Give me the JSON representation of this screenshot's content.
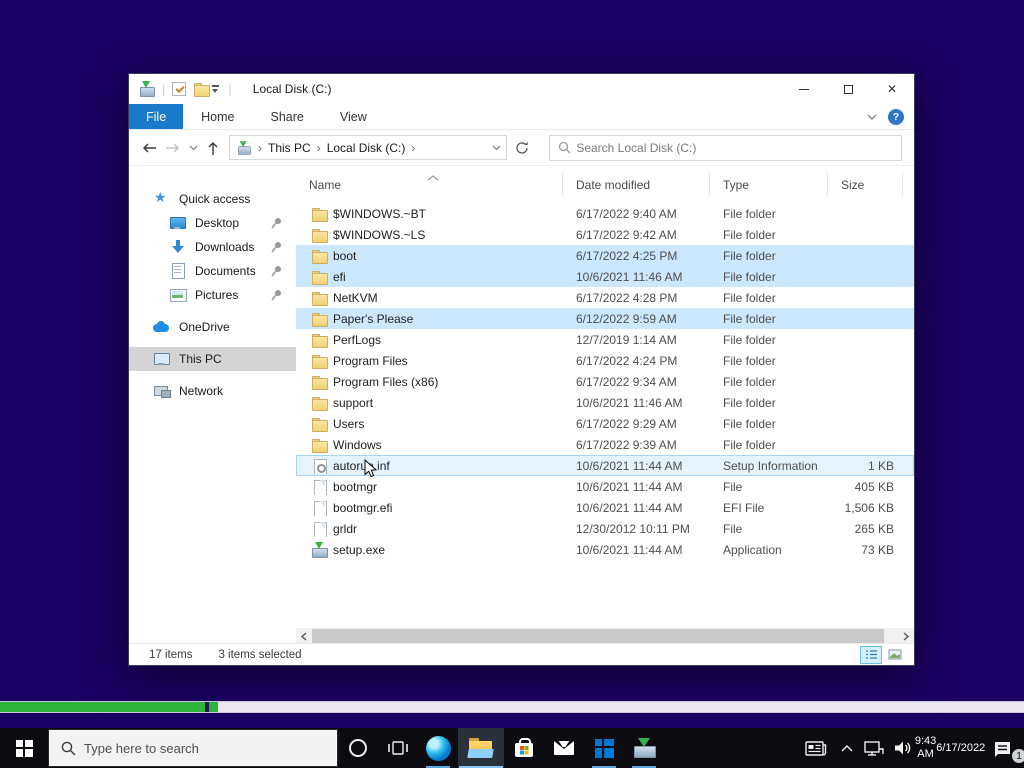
{
  "colors": {
    "accent": "#1979ca",
    "selection": "#cce8ff",
    "desktop": "#1c0164",
    "taskbar": "#0c0b10",
    "progress_green": "#2eb33c"
  },
  "window": {
    "title": "Local Disk (C:)",
    "tabs": [
      {
        "label": "File"
      },
      {
        "label": "Home"
      },
      {
        "label": "Share"
      },
      {
        "label": "View"
      }
    ],
    "breadcrumb": {
      "root": "This PC",
      "current": "Local Disk (C:)"
    },
    "search_placeholder": "Search Local Disk (C:)"
  },
  "nav": {
    "items": [
      {
        "label": "Quick access",
        "cls": "i-quick"
      },
      {
        "label": "Desktop",
        "cls": "i-desktop child pin"
      },
      {
        "label": "Downloads",
        "cls": "i-downloads child pin"
      },
      {
        "label": "Documents",
        "cls": "i-documents child pin"
      },
      {
        "label": "Pictures",
        "cls": "i-pictures child pin"
      },
      {
        "label": "OneDrive",
        "cls": "i-onedrive gap"
      },
      {
        "label": "This PC",
        "cls": "i-thispc gap sel"
      },
      {
        "label": "Network",
        "cls": "i-network gap"
      }
    ]
  },
  "files": {
    "columns": [
      {
        "label": "Name"
      },
      {
        "label": "Date modified"
      },
      {
        "label": "Type"
      },
      {
        "label": "Size"
      }
    ],
    "rows": [
      {
        "name": "$WINDOWS.~BT",
        "date": "6/17/2022 9:40 AM",
        "type": "File folder",
        "size": "",
        "cls": "f-folder"
      },
      {
        "name": "$WINDOWS.~LS",
        "date": "6/17/2022 9:42 AM",
        "type": "File folder",
        "size": "",
        "cls": "f-folder"
      },
      {
        "name": "boot",
        "date": "6/17/2022 4:25 PM",
        "type": "File folder",
        "size": "",
        "cls": "f-folder sel"
      },
      {
        "name": "efi",
        "date": "10/6/2021 11:46 AM",
        "type": "File folder",
        "size": "",
        "cls": "f-folder sel"
      },
      {
        "name": "NetKVM",
        "date": "6/17/2022 4:28 PM",
        "type": "File folder",
        "size": "",
        "cls": "f-folder"
      },
      {
        "name": "Paper's Please",
        "date": "6/12/2022 9:59 AM",
        "type": "File folder",
        "size": "",
        "cls": "f-folder sel"
      },
      {
        "name": "PerfLogs",
        "date": "12/7/2019 1:14 AM",
        "type": "File folder",
        "size": "",
        "cls": "f-folder"
      },
      {
        "name": "Program Files",
        "date": "6/17/2022 4:24 PM",
        "type": "File folder",
        "size": "",
        "cls": "f-folder"
      },
      {
        "name": "Program Files (x86)",
        "date": "6/17/2022 9:34 AM",
        "type": "File folder",
        "size": "",
        "cls": "f-folder"
      },
      {
        "name": "support",
        "date": "10/6/2021 11:46 AM",
        "type": "File folder",
        "size": "",
        "cls": "f-folder"
      },
      {
        "name": "Users",
        "date": "6/17/2022 9:29 AM",
        "type": "File folder",
        "size": "",
        "cls": "f-folder"
      },
      {
        "name": "Windows",
        "date": "6/17/2022 9:39 AM",
        "type": "File folder",
        "size": "",
        "cls": "f-folder"
      },
      {
        "name": "autorun.inf",
        "date": "10/6/2021 11:44 AM",
        "type": "Setup Information",
        "size": "1 KB",
        "cls": "f-inf hover"
      },
      {
        "name": "bootmgr",
        "date": "10/6/2021 11:44 AM",
        "type": "File",
        "size": "405 KB",
        "cls": "f-file"
      },
      {
        "name": "bootmgr.efi",
        "date": "10/6/2021 11:44 AM",
        "type": "EFI File",
        "size": "1,506 KB",
        "cls": "f-file"
      },
      {
        "name": "grldr",
        "date": "12/30/2012 10:11 PM",
        "type": "File",
        "size": "265 KB",
        "cls": "f-file"
      },
      {
        "name": "setup.exe",
        "date": "10/6/2021 11:44 AM",
        "type": "Application",
        "size": "73 KB",
        "cls": "f-exe"
      }
    ]
  },
  "status": {
    "count": "17 items",
    "selected": "3 items selected"
  },
  "taskbar": {
    "search_placeholder": "Type here to search",
    "time": "9:43 AM",
    "date": "6/17/2022",
    "notification_count": "1"
  },
  "progress": {
    "percent": 20
  }
}
